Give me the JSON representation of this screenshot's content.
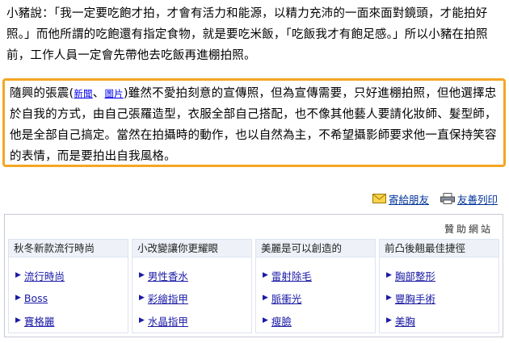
{
  "article": {
    "para1": "小豬說：「我一定要吃飽才拍，才會有活力和能源，以精力充沛的一面來面對鏡頭，才能拍好照。」而他所謂的吃飽還有指定食物，就是要吃米飯，「吃飯我才有飽足感。」所以小豬在拍照前，工作人員一定會先帶他去吃飯再進棚拍照。",
    "para2_start": "隨興的張震(",
    "link_news": "新聞",
    "sep": "、",
    "link_photo": "圖片",
    "para2_rest": ")雖然不愛拍刻意的宣傳照，但為宣傳需要，只好進棚拍照，但他選擇忠於自我的方式，由自己張羅造型，衣服全部自己搭配，也不像其他藝人要請化妝師、髮型師，他是全部自己搞定。當然在拍攝時的動作，也以自然為主，不希望攝影師要求他一直保持笑容的表情，而是要拍出自我風格。"
  },
  "tools": {
    "send_label": "寄給朋友",
    "print_label": "友善列印"
  },
  "sponsor": {
    "title": "贊助網站",
    "columns": [
      {
        "heading": "秋冬新款流行時尚",
        "items": [
          "流行時尚",
          "Boss",
          "寶格麗"
        ]
      },
      {
        "heading": "小改變讓你更耀眼",
        "items": [
          "男性香水",
          "彩繪指甲",
          "水晶指甲"
        ]
      },
      {
        "heading": "美麗是可以創造的",
        "items": [
          "雷射除毛",
          "脈衝光",
          "瘦臉"
        ]
      },
      {
        "heading": "前凸後翹最佳捷徑",
        "items": [
          "胸部整形",
          "豐胸手術",
          "美胸"
        ]
      }
    ]
  },
  "colors": {
    "highlight_border": "#f5a623",
    "link": "#1a1aa6"
  }
}
